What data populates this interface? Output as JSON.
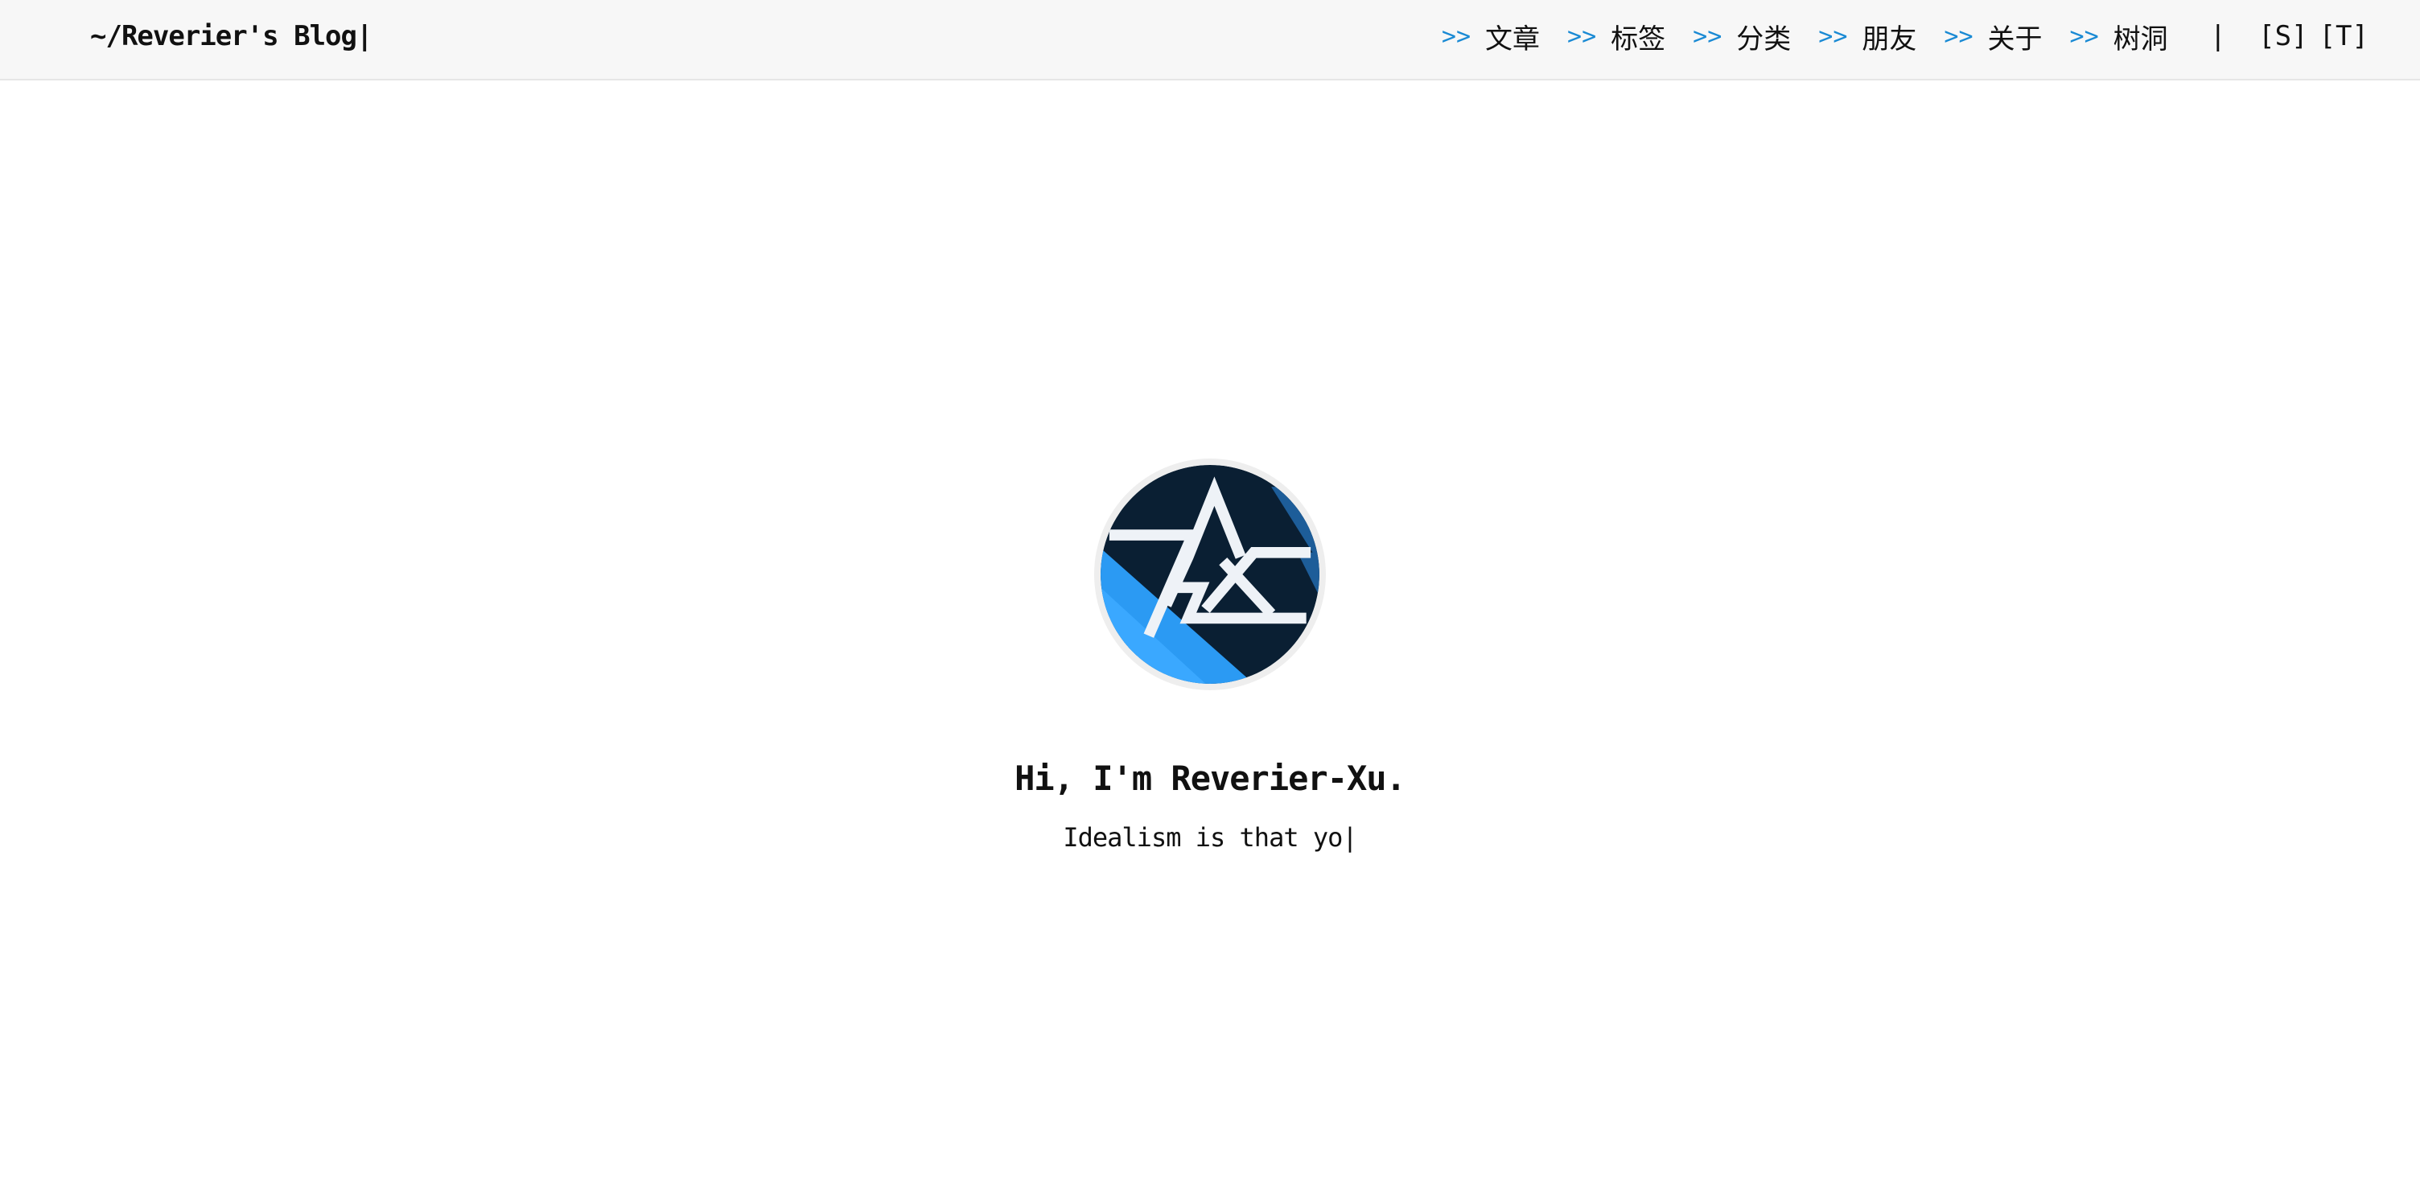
{
  "header": {
    "brand": "~/Reverier's Blog|",
    "nav": [
      {
        "arrow": ">>",
        "label": "文章"
      },
      {
        "arrow": ">>",
        "label": "标签"
      },
      {
        "arrow": ">>",
        "label": "分类"
      },
      {
        "arrow": ">>",
        "label": "朋友"
      },
      {
        "arrow": ">>",
        "label": "关于"
      },
      {
        "arrow": ">>",
        "label": "树洞"
      }
    ],
    "separator": "|",
    "search_toggle": "[S]",
    "theme_toggle": "[T]"
  },
  "hero": {
    "title": "Hi, I'm Reverier-Xu.",
    "subtitle": "Idealism is that yo|"
  },
  "colors": {
    "accent": "#1a8ad4",
    "header_bg": "#f7f7f7",
    "avatar_dark": "#0a1f33",
    "avatar_light": "#2b9af3"
  },
  "icons": {
    "avatar": "rx-logo-avatar",
    "nav_arrow": "double-chevron-right-icon"
  }
}
